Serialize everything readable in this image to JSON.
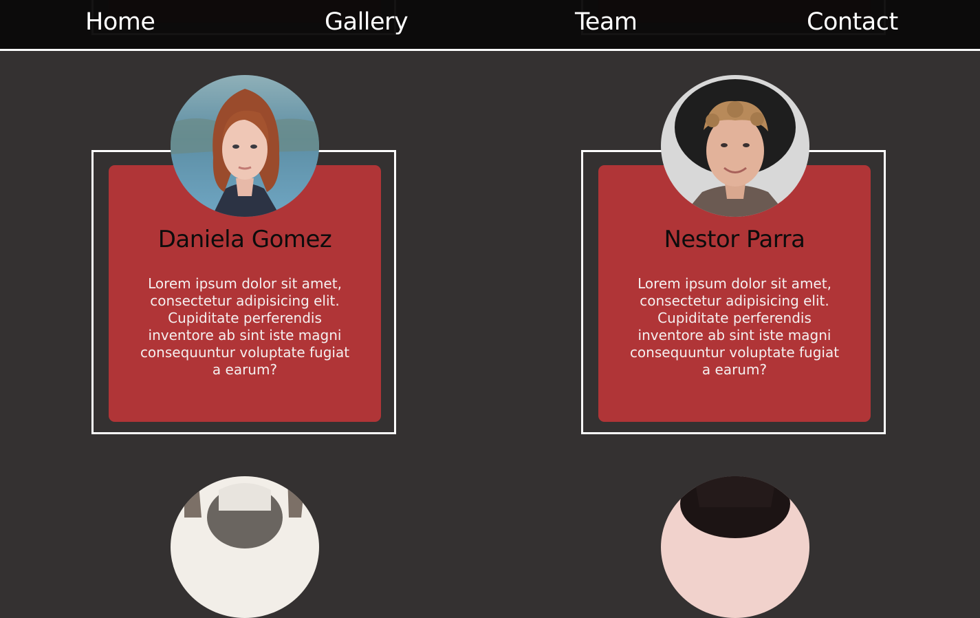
{
  "nav": {
    "items": [
      {
        "label": "Home"
      },
      {
        "label": "Gallery"
      },
      {
        "label": "Team"
      },
      {
        "label": "Contact"
      }
    ]
  },
  "team": [
    {
      "name": "Daniela Gomez",
      "bio": "Lorem ipsum dolor sit amet, consectetur adipisicing elit. Cupiditate perferendis inventore ab sint iste magni consequuntur voluptate fugiat a earum?"
    },
    {
      "name": "Nestor Parra",
      "bio": "Lorem ipsum dolor sit amet, consectetur adipisicing elit. Cupiditate perferendis inventore ab sint iste magni consequuntur voluptate fugiat a earum?"
    }
  ],
  "colors": {
    "page_bg": "#343131",
    "card_bg": "#b03537",
    "card_border": "#ffffff",
    "nav_bg": "#0a0909"
  }
}
